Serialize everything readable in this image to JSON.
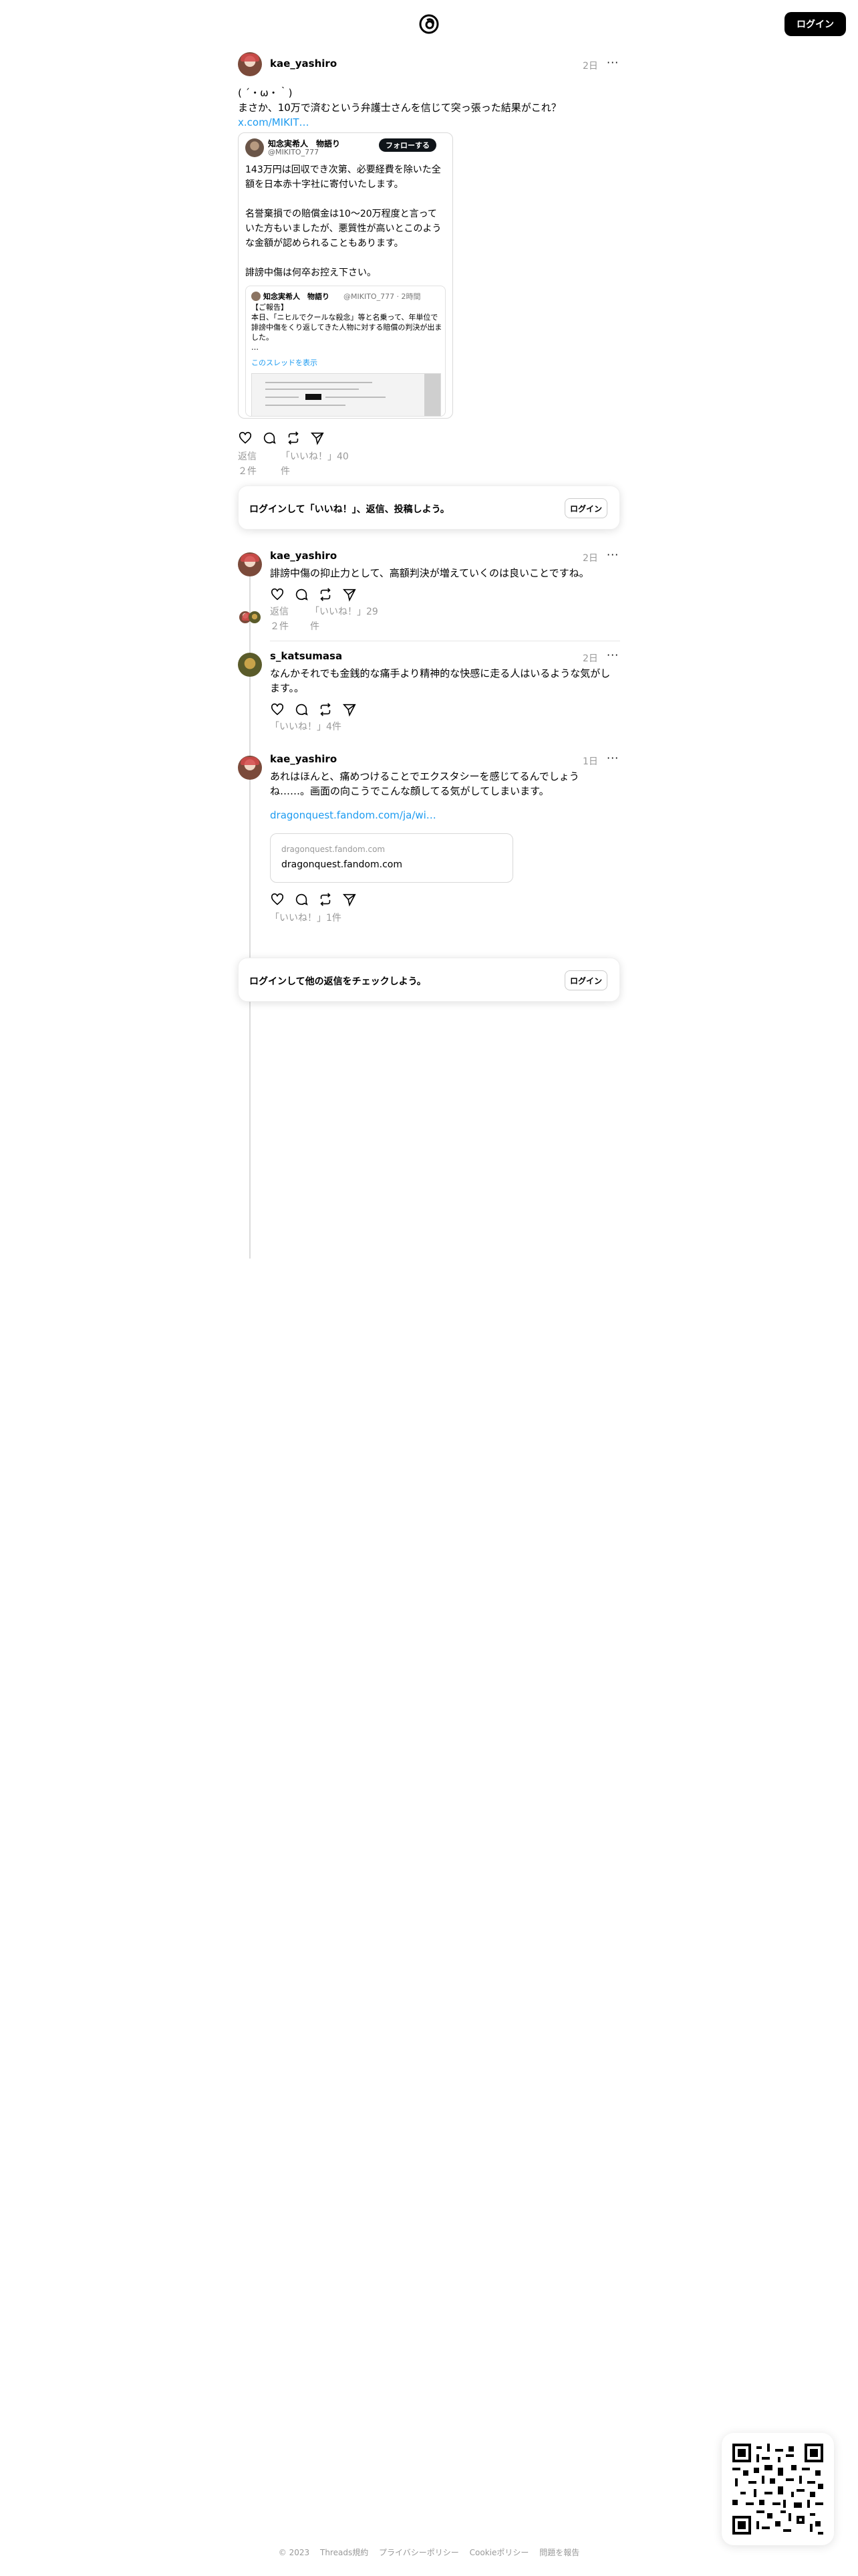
{
  "header": {
    "login_label": "ログイン"
  },
  "main_post": {
    "username": "kae_yashiro",
    "time": "2日",
    "line1": "( ´・ω・｀)",
    "line2": "まさか、10万で済むという弁護士さんを信じて突っ張った結果がこれ？",
    "link": "x.com/MIKIT…",
    "embed": {
      "name": "知念実希人　物語り",
      "handle": "@MIKITO_777",
      "follow_label": "フォローする",
      "body": "143万円は回収でき次第、必要経費を除いた全額を日本赤十字社に寄付いたします。\n\n名誉棄損での賠償金は10〜20万程度と言っていた方もいましたが、悪質性が高いとこのような金額が認められることもあります。\n\n誹謗中傷は何卒お控え下さい。",
      "quote": {
        "name": "知念実希人　物語り",
        "meta": "@MIKITO_777 · 2時間",
        "body": "【ご報告】\n本日、「ニヒルでクールな殺念」等と名乗って、年単位で誹謗中傷をくり返してきた人物に対する賠償の判決が出ました。\n…",
        "show_thread": "このスレッドを表示"
      }
    },
    "replies": "返信２件",
    "likes": "「いいね！」40件"
  },
  "prompt1": {
    "text": "ログインして「いいね！」、返信、投稿しよう。",
    "button": "ログイン"
  },
  "replies": [
    {
      "username": "kae_yashiro",
      "time": "2日",
      "text": "誹謗中傷の抑止力として、高額判決が増えていくのは良いことですね。",
      "replies": "返信２件",
      "likes": "「いいね！」29件"
    },
    {
      "username": "s_katsumasa",
      "time": "2日",
      "text": "なんかそれでも金銭的な痛手より精神的な快感に走る人はいるような気がします。。",
      "likes": "「いいね！」4件"
    },
    {
      "username": "kae_yashiro",
      "time": "1日",
      "text": "あれはほんと、痛めつけることでエクスタシーを感じてるんでしょうね……。画面の向こうでこんな顔してる気がしてしまいます。",
      "link": "dragonquest.fandom.com/ja/wi…",
      "preview_domain": "dragonquest.fandom.com",
      "preview_title": "dragonquest.fandom.com",
      "likes": "「いいね！」1件"
    }
  ],
  "prompt2": {
    "text": "ログインして他の返信をチェックしよう。",
    "button": "ログイン"
  },
  "footer": {
    "copyright": "© 2023",
    "terms": "Threads規約",
    "privacy": "プライバシーポリシー",
    "cookies": "Cookieポリシー",
    "report": "問題を報告"
  }
}
